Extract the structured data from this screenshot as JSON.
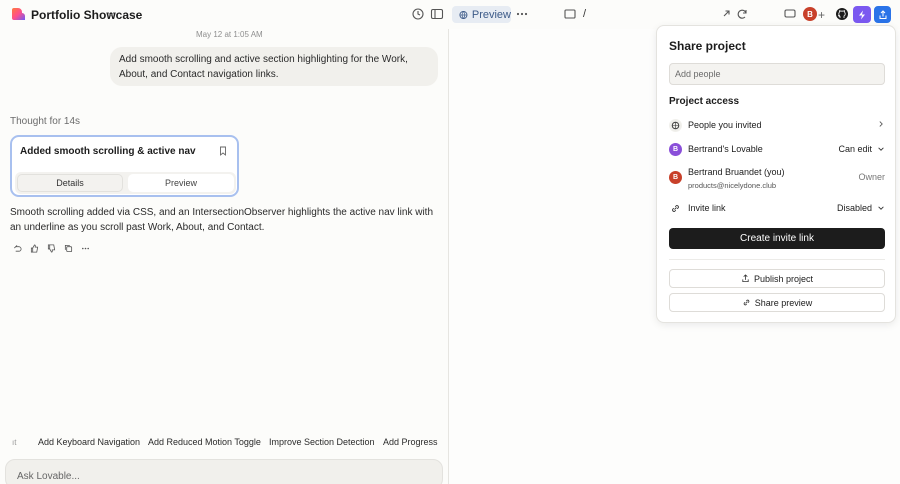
{
  "header": {
    "project_title": "Portfolio Showcase",
    "preview_label": "Preview",
    "url_path": "/",
    "avatar_initial": "B"
  },
  "chat": {
    "timestamp": "May 12 at 1:05 AM",
    "user_message": "Add smooth scrolling and active section highlighting for the Work, About, and Contact navigation links.",
    "thought": "Thought for 14s",
    "card": {
      "title": "Added smooth scrolling & active nav",
      "tab_details": "Details",
      "tab_preview": "Preview"
    },
    "answer": "Smooth scrolling added via CSS, and an IntersectionObserver highlights the active nav link with an underline as you scroll past Work, About, and Contact."
  },
  "suggestions": {
    "first_hint": "ıt",
    "items": [
      "Add Keyboard Navigation",
      "Add Reduced Motion Toggle",
      "Improve Section Detection",
      "Add Progress"
    ]
  },
  "ask": {
    "placeholder": "Ask Lovable..."
  },
  "share": {
    "title": "Share project",
    "add_people_placeholder": "Add people",
    "access_heading": "Project access",
    "rows": {
      "invited": {
        "label": "People you invited"
      },
      "workspace": {
        "initial": "B",
        "label": "Bertrand's Lovable",
        "permission": "Can edit"
      },
      "owner": {
        "initial": "B",
        "label": "Bertrand Bruandet (you)",
        "email": "products@nicelydone.club",
        "role": "Owner"
      },
      "invite_link": {
        "label": "Invite link",
        "status": "Disabled"
      }
    },
    "create_invite_label": "Create invite link",
    "publish_label": "Publish project",
    "share_preview_label": "Share preview"
  },
  "colors": {
    "accent_blue": "#2a73e8",
    "accent_purple": "#7b59f0",
    "avatar_red": "#c8402a",
    "workspace_purple": "#8a4fd9"
  }
}
